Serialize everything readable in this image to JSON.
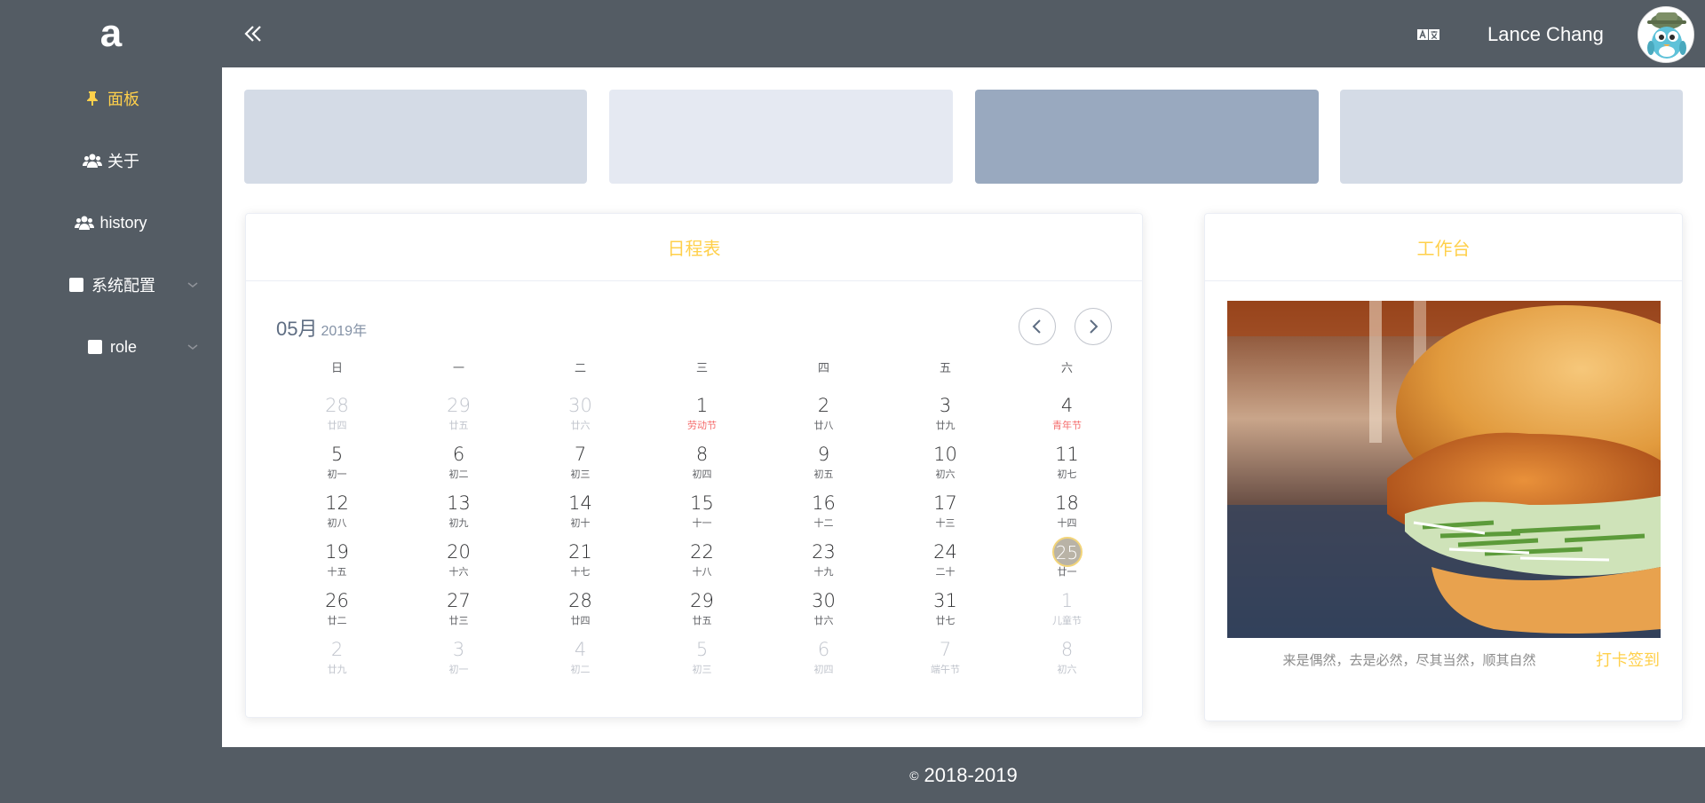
{
  "sidebar": {
    "logo": "a",
    "items": [
      {
        "label": "面板",
        "icon": "pin-icon",
        "active": true
      },
      {
        "label": "关于",
        "icon": "users-icon"
      },
      {
        "label": "history",
        "icon": "users-icon"
      },
      {
        "label": "系统配置",
        "icon": "square-icon",
        "submenu": true
      },
      {
        "label": "role",
        "icon": "square-icon",
        "submenu": true
      }
    ]
  },
  "header": {
    "username": "Lance Chang",
    "collapse_icon": "double-chevron-left-icon",
    "language_icon": "translate-icon",
    "avatar_icon": "avatar-icon"
  },
  "panels": {
    "colors": [
      "#d4dbe6",
      "#e5e9f2",
      "#99a9bf",
      "#d4dbe6"
    ]
  },
  "calendar_card": {
    "title": "日程表",
    "month": "05月",
    "year": "2019年",
    "weekdays": [
      "日",
      "一",
      "二",
      "三",
      "四",
      "五",
      "六"
    ]
  },
  "calendar_days": [
    {
      "n": "28",
      "l": "廿四",
      "other": true
    },
    {
      "n": "29",
      "l": "廿五",
      "other": true
    },
    {
      "n": "30",
      "l": "廿六",
      "other": true
    },
    {
      "n": "1",
      "l": "劳动节",
      "fest": true
    },
    {
      "n": "2",
      "l": "廿八"
    },
    {
      "n": "3",
      "l": "廿九"
    },
    {
      "n": "4",
      "l": "青年节",
      "fest": true
    },
    {
      "n": "5",
      "l": "初一"
    },
    {
      "n": "6",
      "l": "初二"
    },
    {
      "n": "7",
      "l": "初三"
    },
    {
      "n": "8",
      "l": "初四"
    },
    {
      "n": "9",
      "l": "初五"
    },
    {
      "n": "10",
      "l": "初六"
    },
    {
      "n": "11",
      "l": "初七"
    },
    {
      "n": "12",
      "l": "初八"
    },
    {
      "n": "13",
      "l": "初九"
    },
    {
      "n": "14",
      "l": "初十"
    },
    {
      "n": "15",
      "l": "十一"
    },
    {
      "n": "16",
      "l": "十二"
    },
    {
      "n": "17",
      "l": "十三"
    },
    {
      "n": "18",
      "l": "十四"
    },
    {
      "n": "19",
      "l": "十五"
    },
    {
      "n": "20",
      "l": "十六"
    },
    {
      "n": "21",
      "l": "十七"
    },
    {
      "n": "22",
      "l": "十八"
    },
    {
      "n": "23",
      "l": "十九"
    },
    {
      "n": "24",
      "l": "二十"
    },
    {
      "n": "25",
      "l": "廿一",
      "today": true
    },
    {
      "n": "26",
      "l": "廿二"
    },
    {
      "n": "27",
      "l": "廿三"
    },
    {
      "n": "28",
      "l": "廿四"
    },
    {
      "n": "29",
      "l": "廿五"
    },
    {
      "n": "30",
      "l": "廿六"
    },
    {
      "n": "31",
      "l": "廿七"
    },
    {
      "n": "1",
      "l": "儿童节",
      "other": true,
      "fest": true
    },
    {
      "n": "2",
      "l": "廿九",
      "other": true
    },
    {
      "n": "3",
      "l": "初一",
      "other": true
    },
    {
      "n": "4",
      "l": "初二",
      "other": true
    },
    {
      "n": "5",
      "l": "初三",
      "other": true
    },
    {
      "n": "6",
      "l": "初四",
      "other": true
    },
    {
      "n": "7",
      "l": "端午节",
      "other": true,
      "fest": true
    },
    {
      "n": "8",
      "l": "初六",
      "other": true
    }
  ],
  "workbench": {
    "title": "工作台",
    "quote": "来是偶然，去是必然，尽其当然，顺其自然",
    "checkin_label": "打卡签到"
  },
  "footer": {
    "copyright_symbol": "©",
    "years": "2018-2019"
  }
}
